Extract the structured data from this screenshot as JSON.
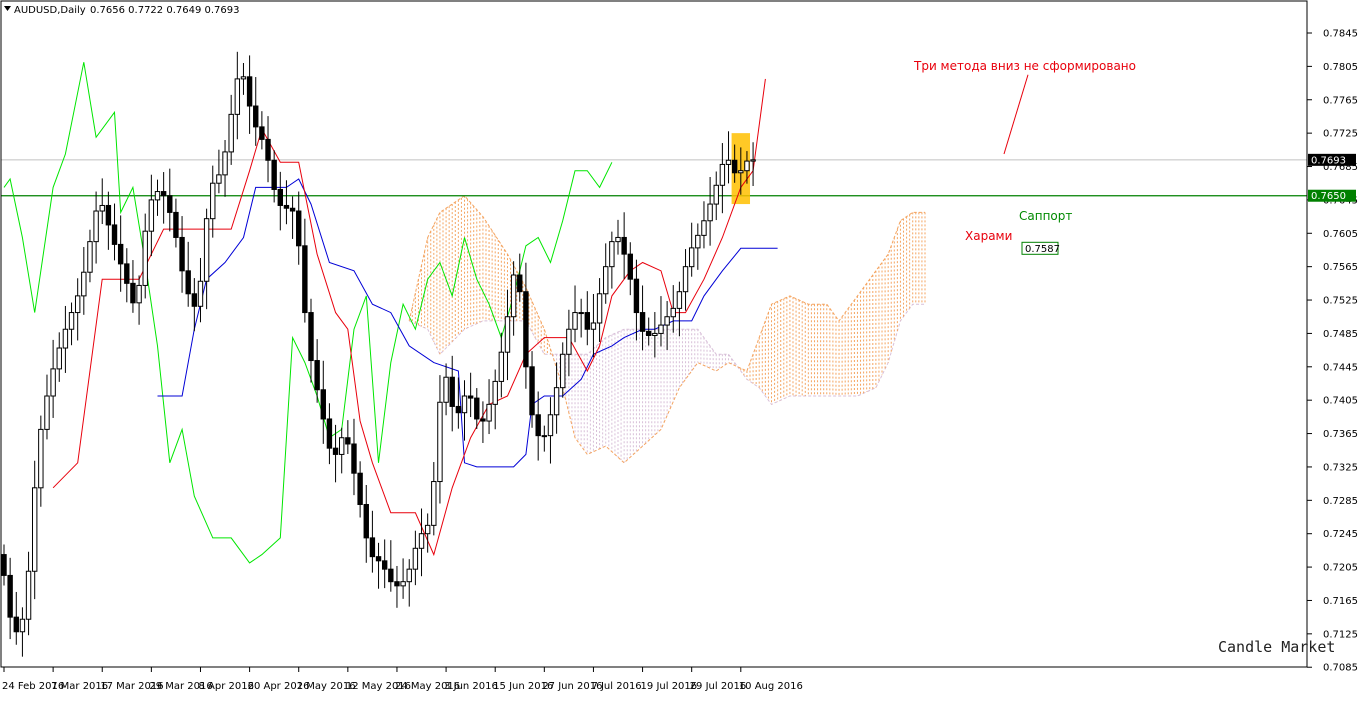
{
  "window": {
    "title": "AUDUSD,Daily",
    "ohlc": "0.7656 0.7722 0.7649 0.7693",
    "watermark": "Candle Market"
  },
  "colors": {
    "background": "#ffffff",
    "candle": "#000000",
    "tenkan": "#e8000c",
    "kijun": "#0000d6",
    "chikou": "#00e600",
    "senkou_a": "#f4a460",
    "senkou_b": "#d8bfd8",
    "support": "#008000",
    "price_line": "#c0c0c0",
    "highlight": "#ffc000"
  },
  "chart_data": {
    "type": "candlestick",
    "symbol": "AUDUSD",
    "timeframe": "Daily",
    "ylim": [
      0.7085,
      0.787
    ],
    "y_ticks": [
      "0.7845",
      "0.7805",
      "0.7765",
      "0.7725",
      "0.7685",
      "0.7645",
      "0.7605",
      "0.7565",
      "0.7525",
      "0.7485",
      "0.7445",
      "0.7405",
      "0.7365",
      "0.7325",
      "0.7285",
      "0.7245",
      "0.7205",
      "0.7165",
      "0.7125",
      "0.7085"
    ],
    "x_ticks": [
      {
        "label": "24 Feb 2016",
        "bar": 0
      },
      {
        "label": "7 Mar 2016",
        "bar": 8
      },
      {
        "label": "17 Mar 2016",
        "bar": 16
      },
      {
        "label": "29 Mar 2016",
        "bar": 24
      },
      {
        "label": "8 Apr 2016",
        "bar": 32
      },
      {
        "label": "20 Apr 2016",
        "bar": 40
      },
      {
        "label": "2 May 2016",
        "bar": 48
      },
      {
        "label": "12 May 2016",
        "bar": 56
      },
      {
        "label": "24 May 2016",
        "bar": 64
      },
      {
        "label": "3 Jun 2016",
        "bar": 72
      },
      {
        "label": "15 Jun 2016",
        "bar": 80
      },
      {
        "label": "27 Jun 2016",
        "bar": 88
      },
      {
        "label": "7 Jul 2016",
        "bar": 96
      },
      {
        "label": "19 Jul 2016",
        "bar": 104
      },
      {
        "label": "29 Jul 2016",
        "bar": 112
      },
      {
        "label": "10 Aug 2016",
        "bar": 120
      }
    ],
    "current_price": {
      "value": 0.7693,
      "label": "0.7693"
    },
    "support_level": {
      "value": 0.765,
      "label": "0.7650",
      "annotation": "Саппорт"
    },
    "kijun_label": {
      "value": 0.7587,
      "label": "0.7587"
    },
    "annotations": [
      {
        "text": "Три метода вниз не сформировано",
        "color": "red"
      },
      {
        "text": "Харами",
        "color": "red"
      }
    ],
    "harami_highlight": {
      "bar_from": 118.5,
      "bar_to": 121.5,
      "price_low": 0.764,
      "price_high": 0.7725
    },
    "anchors": [
      {
        "bar": 0,
        "price": 0.722
      },
      {
        "bar": 2,
        "price": 0.712
      },
      {
        "bar": 4,
        "price": 0.715
      },
      {
        "bar": 6,
        "price": 0.735
      },
      {
        "bar": 8,
        "price": 0.743
      },
      {
        "bar": 10,
        "price": 0.748
      },
      {
        "bar": 13,
        "price": 0.754
      },
      {
        "bar": 16,
        "price": 0.765
      },
      {
        "bar": 19,
        "price": 0.758
      },
      {
        "bar": 22,
        "price": 0.751
      },
      {
        "bar": 24,
        "price": 0.764
      },
      {
        "bar": 26,
        "price": 0.766
      },
      {
        "bar": 28,
        "price": 0.762
      },
      {
        "bar": 30,
        "price": 0.754
      },
      {
        "bar": 32,
        "price": 0.751
      },
      {
        "bar": 34,
        "price": 0.766
      },
      {
        "bar": 36,
        "price": 0.768
      },
      {
        "bar": 38,
        "price": 0.777
      },
      {
        "bar": 39,
        "price": 0.781
      },
      {
        "bar": 41,
        "price": 0.774
      },
      {
        "bar": 43,
        "price": 0.771
      },
      {
        "bar": 45,
        "price": 0.764
      },
      {
        "bar": 48,
        "price": 0.763
      },
      {
        "bar": 50,
        "price": 0.747
      },
      {
        "bar": 52,
        "price": 0.74
      },
      {
        "bar": 54,
        "price": 0.733
      },
      {
        "bar": 56,
        "price": 0.737
      },
      {
        "bar": 58,
        "price": 0.73
      },
      {
        "bar": 60,
        "price": 0.722
      },
      {
        "bar": 62,
        "price": 0.721
      },
      {
        "bar": 64,
        "price": 0.718
      },
      {
        "bar": 66,
        "price": 0.719
      },
      {
        "bar": 68,
        "price": 0.724
      },
      {
        "bar": 70,
        "price": 0.726
      },
      {
        "bar": 72,
        "price": 0.745
      },
      {
        "bar": 74,
        "price": 0.738
      },
      {
        "bar": 76,
        "price": 0.742
      },
      {
        "bar": 78,
        "price": 0.737
      },
      {
        "bar": 80,
        "price": 0.741
      },
      {
        "bar": 82,
        "price": 0.748
      },
      {
        "bar": 84,
        "price": 0.758
      },
      {
        "bar": 86,
        "price": 0.74
      },
      {
        "bar": 88,
        "price": 0.735
      },
      {
        "bar": 90,
        "price": 0.74
      },
      {
        "bar": 92,
        "price": 0.748
      },
      {
        "bar": 94,
        "price": 0.752
      },
      {
        "bar": 96,
        "price": 0.748
      },
      {
        "bar": 98,
        "price": 0.755
      },
      {
        "bar": 100,
        "price": 0.761
      },
      {
        "bar": 102,
        "price": 0.757
      },
      {
        "bar": 104,
        "price": 0.749
      },
      {
        "bar": 106,
        "price": 0.748
      },
      {
        "bar": 108,
        "price": 0.75
      },
      {
        "bar": 110,
        "price": 0.752
      },
      {
        "bar": 112,
        "price": 0.758
      },
      {
        "bar": 114,
        "price": 0.761
      },
      {
        "bar": 116,
        "price": 0.765
      },
      {
        "bar": 118,
        "price": 0.77
      },
      {
        "bar": 120,
        "price": 0.767
      },
      {
        "bar": 121,
        "price": 0.769
      },
      {
        "bar": 122,
        "price": 0.7693
      }
    ],
    "tenkan": [
      {
        "bar": 8,
        "price": 0.73
      },
      {
        "bar": 12,
        "price": 0.733
      },
      {
        "bar": 16,
        "price": 0.755
      },
      {
        "bar": 22,
        "price": 0.755
      },
      {
        "bar": 26,
        "price": 0.761
      },
      {
        "bar": 31,
        "price": 0.761
      },
      {
        "bar": 37,
        "price": 0.761
      },
      {
        "bar": 40,
        "price": 0.768
      },
      {
        "bar": 42,
        "price": 0.773
      },
      {
        "bar": 45,
        "price": 0.769
      },
      {
        "bar": 48,
        "price": 0.769
      },
      {
        "bar": 51,
        "price": 0.758
      },
      {
        "bar": 54,
        "price": 0.751
      },
      {
        "bar": 56,
        "price": 0.749
      },
      {
        "bar": 58,
        "price": 0.738
      },
      {
        "bar": 60,
        "price": 0.733
      },
      {
        "bar": 63,
        "price": 0.727
      },
      {
        "bar": 67,
        "price": 0.727
      },
      {
        "bar": 70,
        "price": 0.722
      },
      {
        "bar": 73,
        "price": 0.73
      },
      {
        "bar": 76,
        "price": 0.736
      },
      {
        "bar": 79,
        "price": 0.74
      },
      {
        "bar": 82,
        "price": 0.741
      },
      {
        "bar": 85,
        "price": 0.746
      },
      {
        "bar": 88,
        "price": 0.748
      },
      {
        "bar": 92,
        "price": 0.748
      },
      {
        "bar": 95,
        "price": 0.744
      },
      {
        "bar": 97,
        "price": 0.747
      },
      {
        "bar": 99,
        "price": 0.753
      },
      {
        "bar": 102,
        "price": 0.756
      },
      {
        "bar": 104,
        "price": 0.757
      },
      {
        "bar": 107,
        "price": 0.756
      },
      {
        "bar": 109,
        "price": 0.751
      },
      {
        "bar": 111,
        "price": 0.751
      },
      {
        "bar": 114,
        "price": 0.755
      },
      {
        "bar": 117,
        "price": 0.76
      },
      {
        "bar": 120,
        "price": 0.766
      },
      {
        "bar": 122,
        "price": 0.768
      },
      {
        "bar": 124,
        "price": 0.779
      }
    ],
    "kijun": [
      {
        "bar": 25,
        "price": 0.741
      },
      {
        "bar": 29,
        "price": 0.741
      },
      {
        "bar": 31,
        "price": 0.749
      },
      {
        "bar": 33,
        "price": 0.755
      },
      {
        "bar": 36,
        "price": 0.757
      },
      {
        "bar": 39,
        "price": 0.76
      },
      {
        "bar": 41,
        "price": 0.766
      },
      {
        "bar": 46,
        "price": 0.766
      },
      {
        "bar": 48,
        "price": 0.767
      },
      {
        "bar": 50,
        "price": 0.764
      },
      {
        "bar": 53,
        "price": 0.757
      },
      {
        "bar": 57,
        "price": 0.756
      },
      {
        "bar": 60,
        "price": 0.752
      },
      {
        "bar": 63,
        "price": 0.751
      },
      {
        "bar": 66,
        "price": 0.747
      },
      {
        "bar": 70,
        "price": 0.745
      },
      {
        "bar": 74,
        "price": 0.744
      },
      {
        "bar": 75,
        "price": 0.733
      },
      {
        "bar": 77,
        "price": 0.7325
      },
      {
        "bar": 83,
        "price": 0.7325
      },
      {
        "bar": 85,
        "price": 0.734
      },
      {
        "bar": 86,
        "price": 0.74
      },
      {
        "bar": 88,
        "price": 0.741
      },
      {
        "bar": 91,
        "price": 0.741
      },
      {
        "bar": 94,
        "price": 0.743
      },
      {
        "bar": 96,
        "price": 0.746
      },
      {
        "bar": 99,
        "price": 0.747
      },
      {
        "bar": 101,
        "price": 0.748
      },
      {
        "bar": 104,
        "price": 0.749
      },
      {
        "bar": 106,
        "price": 0.749
      },
      {
        "bar": 109,
        "price": 0.75
      },
      {
        "bar": 112,
        "price": 0.75
      },
      {
        "bar": 114,
        "price": 0.753
      },
      {
        "bar": 117,
        "price": 0.756
      },
      {
        "bar": 120,
        "price": 0.7587
      },
      {
        "bar": 126,
        "price": 0.7587
      }
    ],
    "chikou": [
      {
        "bar": 0,
        "price": 0.766
      },
      {
        "bar": 1,
        "price": 0.767
      },
      {
        "bar": 3,
        "price": 0.76
      },
      {
        "bar": 5,
        "price": 0.751
      },
      {
        "bar": 8,
        "price": 0.766
      },
      {
        "bar": 10,
        "price": 0.77
      },
      {
        "bar": 13,
        "price": 0.781
      },
      {
        "bar": 15,
        "price": 0.772
      },
      {
        "bar": 18,
        "price": 0.775
      },
      {
        "bar": 19,
        "price": 0.763
      },
      {
        "bar": 21,
        "price": 0.766
      },
      {
        "bar": 23,
        "price": 0.757
      },
      {
        "bar": 25,
        "price": 0.747
      },
      {
        "bar": 27,
        "price": 0.733
      },
      {
        "bar": 29,
        "price": 0.737
      },
      {
        "bar": 31,
        "price": 0.729
      },
      {
        "bar": 34,
        "price": 0.724
      },
      {
        "bar": 37,
        "price": 0.724
      },
      {
        "bar": 40,
        "price": 0.721
      },
      {
        "bar": 42,
        "price": 0.722
      },
      {
        "bar": 45,
        "price": 0.724
      },
      {
        "bar": 47,
        "price": 0.748
      },
      {
        "bar": 49,
        "price": 0.745
      },
      {
        "bar": 51,
        "price": 0.741
      },
      {
        "bar": 53,
        "price": 0.736
      },
      {
        "bar": 55,
        "price": 0.737
      },
      {
        "bar": 57,
        "price": 0.749
      },
      {
        "bar": 59,
        "price": 0.753
      },
      {
        "bar": 61,
        "price": 0.733
      },
      {
        "bar": 63,
        "price": 0.745
      },
      {
        "bar": 65,
        "price": 0.752
      },
      {
        "bar": 67,
        "price": 0.749
      },
      {
        "bar": 69,
        "price": 0.755
      },
      {
        "bar": 71,
        "price": 0.757
      },
      {
        "bar": 73,
        "price": 0.753
      },
      {
        "bar": 75,
        "price": 0.76
      },
      {
        "bar": 77,
        "price": 0.755
      },
      {
        "bar": 79,
        "price": 0.752
      },
      {
        "bar": 81,
        "price": 0.748
      },
      {
        "bar": 83,
        "price": 0.753
      },
      {
        "bar": 85,
        "price": 0.759
      },
      {
        "bar": 87,
        "price": 0.76
      },
      {
        "bar": 89,
        "price": 0.757
      },
      {
        "bar": 91,
        "price": 0.762
      },
      {
        "bar": 93,
        "price": 0.768
      },
      {
        "bar": 95,
        "price": 0.768
      },
      {
        "bar": 97,
        "price": 0.766
      },
      {
        "bar": 99,
        "price": 0.769
      }
    ],
    "senkou_a": [
      {
        "bar": 66,
        "price": 0.75
      },
      {
        "bar": 69,
        "price": 0.76
      },
      {
        "bar": 71,
        "price": 0.763
      },
      {
        "bar": 75,
        "price": 0.765
      },
      {
        "bar": 78,
        "price": 0.7625
      },
      {
        "bar": 82,
        "price": 0.758
      },
      {
        "bar": 85,
        "price": 0.754
      },
      {
        "bar": 88,
        "price": 0.749
      },
      {
        "bar": 91,
        "price": 0.742
      },
      {
        "bar": 93,
        "price": 0.736
      },
      {
        "bar": 95,
        "price": 0.734
      },
      {
        "bar": 98,
        "price": 0.735
      },
      {
        "bar": 101,
        "price": 0.733
      },
      {
        "bar": 104,
        "price": 0.735
      },
      {
        "bar": 107,
        "price": 0.737
      },
      {
        "bar": 110,
        "price": 0.742
      },
      {
        "bar": 113,
        "price": 0.745
      },
      {
        "bar": 116,
        "price": 0.744
      },
      {
        "bar": 118,
        "price": 0.745
      },
      {
        "bar": 121,
        "price": 0.744
      },
      {
        "bar": 123,
        "price": 0.748
      },
      {
        "bar": 125,
        "price": 0.752
      },
      {
        "bar": 128,
        "price": 0.753
      },
      {
        "bar": 131,
        "price": 0.752
      },
      {
        "bar": 134,
        "price": 0.752
      },
      {
        "bar": 136,
        "price": 0.75
      },
      {
        "bar": 139,
        "price": 0.753
      },
      {
        "bar": 142,
        "price": 0.756
      },
      {
        "bar": 144,
        "price": 0.758
      },
      {
        "bar": 146,
        "price": 0.762
      },
      {
        "bar": 148,
        "price": 0.763
      },
      {
        "bar": 150,
        "price": 0.763
      }
    ],
    "senkou_b": [
      {
        "bar": 66,
        "price": 0.75
      },
      {
        "bar": 69,
        "price": 0.749
      },
      {
        "bar": 71,
        "price": 0.746
      },
      {
        "bar": 75,
        "price": 0.749
      },
      {
        "bar": 78,
        "price": 0.75
      },
      {
        "bar": 82,
        "price": 0.75
      },
      {
        "bar": 85,
        "price": 0.75
      },
      {
        "bar": 88,
        "price": 0.746
      },
      {
        "bar": 91,
        "price": 0.746
      },
      {
        "bar": 93,
        "price": 0.746
      },
      {
        "bar": 95,
        "price": 0.746
      },
      {
        "bar": 98,
        "price": 0.748
      },
      {
        "bar": 101,
        "price": 0.749
      },
      {
        "bar": 104,
        "price": 0.749
      },
      {
        "bar": 107,
        "price": 0.749
      },
      {
        "bar": 110,
        "price": 0.749
      },
      {
        "bar": 113,
        "price": 0.749
      },
      {
        "bar": 116,
        "price": 0.746
      },
      {
        "bar": 118,
        "price": 0.746
      },
      {
        "bar": 121,
        "price": 0.743
      },
      {
        "bar": 123,
        "price": 0.742
      },
      {
        "bar": 125,
        "price": 0.74
      },
      {
        "bar": 128,
        "price": 0.741
      },
      {
        "bar": 131,
        "price": 0.741
      },
      {
        "bar": 134,
        "price": 0.741
      },
      {
        "bar": 136,
        "price": 0.741
      },
      {
        "bar": 139,
        "price": 0.741
      },
      {
        "bar": 142,
        "price": 0.742
      },
      {
        "bar": 144,
        "price": 0.745
      },
      {
        "bar": 146,
        "price": 0.75
      },
      {
        "bar": 148,
        "price": 0.752
      },
      {
        "bar": 150,
        "price": 0.752
      }
    ]
  }
}
